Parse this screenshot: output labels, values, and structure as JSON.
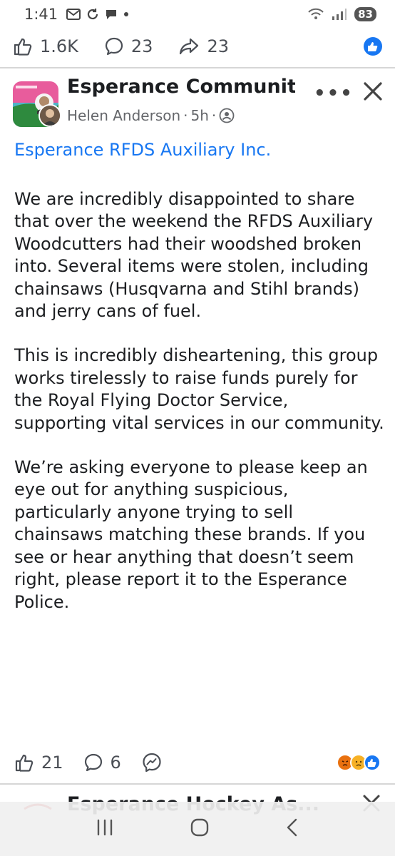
{
  "status_bar": {
    "time": "1:41",
    "battery": "83"
  },
  "engagement": {
    "likes": "1.6K",
    "comments": "23",
    "shares": "23"
  },
  "post": {
    "group_name": "Esperance Communit...",
    "author": "Helen Anderson",
    "time": "5h",
    "link_title": "Esperance RFDS Auxiliary Inc.",
    "paragraphs": [
      "We are incredibly disappointed to share that over the weekend the RFDS Auxiliary Woodcutters had their woodshed broken into. Several items were stolen, including chainsaws (Husqvarna and Stihl brands) and jerry cans of fuel.",
      "This is incredibly disheartening, this group works tirelessly to raise funds purely for the Royal Flying Doctor Service, supporting vital services in our community.",
      "We’re asking everyone to please keep an eye out for anything suspicious, particularly anyone trying to sell chainsaws matching these brands. If you see or hear anything that doesn’t seem right, please report it to the Esperance Police."
    ],
    "likes": "21",
    "comments": "6"
  },
  "next_post": {
    "title": "Esperance Hockey As..."
  },
  "colors": {
    "link_blue": "#1877f2",
    "text": "#1c1e21",
    "muted": "#65676b"
  }
}
